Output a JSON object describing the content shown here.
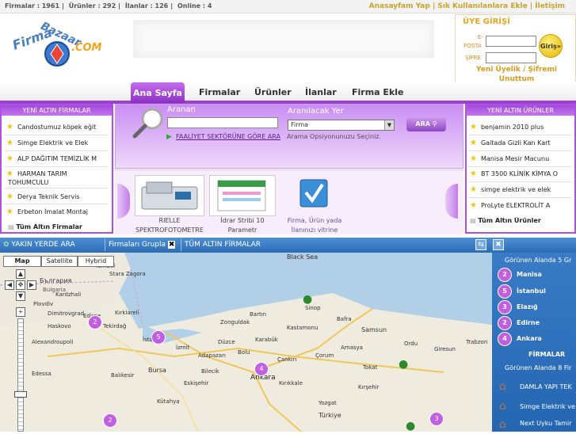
{
  "stats": {
    "firms": "Firmalar : 1961",
    "products": "Ürünler : 292",
    "ads": "İlanlar : 126",
    "online": "Online : 4"
  },
  "top_links": "Anasayfam Yap | Sık Kullanılanlara Ekle | İletişim",
  "logo_text": "FirmaBazaar.COM",
  "login": {
    "title": "ÜYE GİRİŞİ",
    "email_label_1": "E-",
    "email_label_2": "POSTA",
    "password_label": "ŞİFRE",
    "button": "Giriş»",
    "links": "Yeni Üyelik / Şifremi Unuttum"
  },
  "nav": [
    "Ana Sayfa",
    "Firmalar",
    "Ürünler",
    "İlanlar",
    "Firma Ekle"
  ],
  "left_panel": {
    "title": "YENİ ALTIN FİRMALAR",
    "items": [
      "Candostumuz köpek eğit",
      "Simge Elektrik ve Elek",
      "ALP DAĞITIM TEMİZLİK M",
      "HARMAN TARIM",
      "TOHUMCULU",
      "Derya Teknik Servis",
      "Erbeton İmalat Montaj"
    ],
    "footer": "Tüm Altın Firmalar"
  },
  "right_panel": {
    "title": "YENİ ALTIN ÜRÜNLER",
    "items": [
      "benjamin 2010 plus",
      "Gaitada Gizli Kan Kart",
      "Manisa Mesir Macunu",
      "BT 3500 KLİNİK KİMYA O",
      "simge elektrik ve elek",
      "ProLyte ELEKTROLİT A"
    ],
    "footer": "Tüm Altın Ürünler"
  },
  "search": {
    "label": "Aranan",
    "type_label": "Aranılacak Yer",
    "selected": "Firma",
    "sector_link": "FAALİYET SEKTÖRÜNE GÖRE ARA",
    "hint": "Arama Opsiyonunuzu Seçiniz.",
    "button": "ARA"
  },
  "showcase": [
    {
      "line1": "RIELLE",
      "line2": "SPEKTROFOTOMETRE"
    },
    {
      "line1": "İdrar Stribi 10",
      "line2": "Parametr"
    },
    {
      "line1": "Firma, Ürün yada",
      "line2": "İlanınızı vitrine"
    }
  ],
  "map": {
    "tabs": [
      "YAKIN YERDE ARA",
      "Firmaları Grupla",
      "TÜM ALTIN FİRMALAR"
    ],
    "modes": [
      "Map",
      "Satellite",
      "Hybrid"
    ],
    "labels": [
      "Black Sea",
      "България",
      "Bulgaria",
      "Edirne",
      "Kırklareli",
      "Tekirdağ",
      "İstanbul",
      "İzmit",
      "Bursa",
      "Balıkesir",
      "Eskişehir",
      "Kütahya",
      "Zonguldak",
      "Bartın",
      "Kastamonu",
      "Sinop",
      "Bafra",
      "Samsun",
      "Ankara",
      "Kırıkkale",
      "Çorum",
      "Amasya",
      "Tokat",
      "Ordu",
      "Giresun",
      "Trabzon",
      "Kırşehir",
      "Yozgat",
      "Türkiye",
      "Karabük",
      "Bolu",
      "Adapazarı",
      "Düzce",
      "Bilecik",
      "Çankırı",
      "Kardzhali",
      "Plovdiv",
      "Dimitrovgrad",
      "Haskovo",
      "Yambol",
      "Stara Zagora",
      "Alexandroupoli",
      "Edessa"
    ],
    "markers": [
      {
        "label": "2"
      },
      {
        "label": "5"
      },
      {
        "label": "4"
      },
      {
        "label": "3"
      },
      {
        "label": "2"
      }
    ],
    "right_head": "Görünen Alanda 5 Gr",
    "cities": [
      {
        "count": "2",
        "name": "Manisa"
      },
      {
        "count": "5",
        "name": "İstanbul"
      },
      {
        "count": "3",
        "name": "Elazığ"
      },
      {
        "count": "2",
        "name": "Edirne"
      },
      {
        "count": "4",
        "name": "Ankara"
      }
    ],
    "firms_title": "FİRMALAR",
    "firms_head": "Görünen Alanda 8 Fir",
    "firms": [
      "DAMLA YAPI TEK",
      "Simge Elektrik ve",
      "Next Uyku Tamir"
    ]
  }
}
